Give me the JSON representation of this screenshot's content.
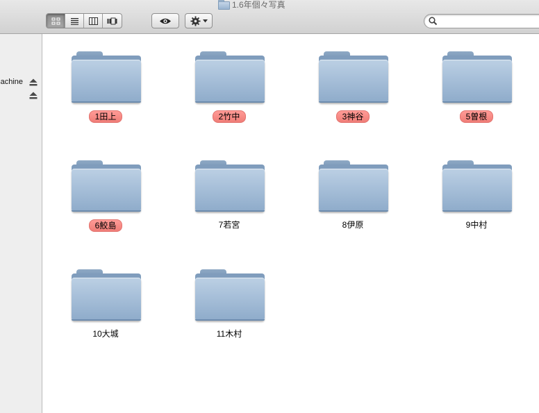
{
  "window": {
    "title": "1.6年個々写真"
  },
  "toolbar": {
    "view_modes": [
      {
        "name": "icon-view",
        "active": true
      },
      {
        "name": "list-view",
        "active": false
      },
      {
        "name": "column-view",
        "active": false
      },
      {
        "name": "coverflow-view",
        "active": false
      }
    ],
    "quicklook_icon": "eye-icon",
    "action_icon": "gear-icon",
    "search": {
      "value": "",
      "placeholder": ""
    }
  },
  "sidebar": {
    "items": [
      {
        "label": "achine",
        "eject": true
      },
      {
        "label": "",
        "eject": true
      }
    ]
  },
  "folders": [
    {
      "name": "1田上",
      "label_color": "#f28a85"
    },
    {
      "name": "2竹中",
      "label_color": "#f28a85"
    },
    {
      "name": "3神谷",
      "label_color": "#f28a85"
    },
    {
      "name": "5曽根",
      "label_color": "#f28a85"
    },
    {
      "name": "6鮫島",
      "label_color": "#f28a85"
    },
    {
      "name": "7若宮",
      "label_color": null
    },
    {
      "name": "8伊原",
      "label_color": null
    },
    {
      "name": "9中村",
      "label_color": null
    },
    {
      "name": "10大城",
      "label_color": null
    },
    {
      "name": "11木村",
      "label_color": null
    }
  ]
}
